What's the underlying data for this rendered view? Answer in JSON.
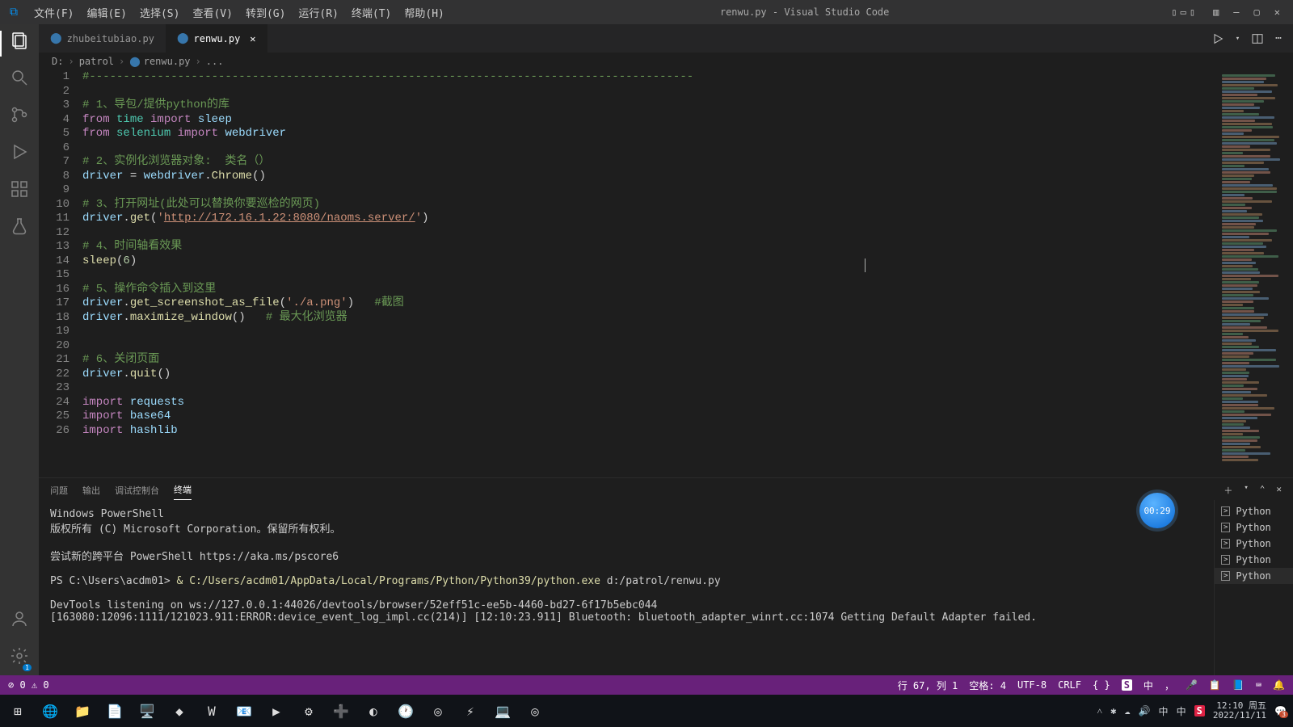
{
  "title": "renwu.py - Visual Studio Code",
  "menu": [
    "文件(F)",
    "编辑(E)",
    "选择(S)",
    "查看(V)",
    "转到(G)",
    "运行(R)",
    "终端(T)",
    "帮助(H)"
  ],
  "tabs": [
    {
      "name": "zhubeitubiao.py",
      "active": false
    },
    {
      "name": "renwu.py",
      "active": true
    }
  ],
  "breadcrumbs": [
    "D:",
    "patrol",
    "renwu.py",
    "..."
  ],
  "code_lines": [
    {
      "n": 1,
      "t": "#-----------------------------------------------------------------------------------------",
      "cls": "comment"
    },
    {
      "n": 2,
      "t": "",
      "cls": ""
    },
    {
      "n": 3,
      "t": "# 1、导包/提供python的库",
      "cls": "comment"
    },
    {
      "n": 4,
      "html": "<span class='c-kw'>from</span> <span class='c-mod'>time</span> <span class='c-kw'>import</span> <span class='c-var'>sleep</span>"
    },
    {
      "n": 5,
      "html": "<span class='c-kw'>from</span> <span class='c-mod'>selenium</span> <span class='c-kw'>import</span> <span class='c-var'>webdriver</span>"
    },
    {
      "n": 6,
      "t": "",
      "cls": ""
    },
    {
      "n": 7,
      "t": "# 2、实例化浏览器对象:  类名（）",
      "cls": "comment"
    },
    {
      "n": 8,
      "html": "<span class='c-var'>driver</span> <span class='c-op'>=</span> <span class='c-var'>webdriver</span><span class='c-op'>.</span><span class='c-fn'>Chrome</span><span class='c-op'>()</span>"
    },
    {
      "n": 9,
      "t": "",
      "cls": ""
    },
    {
      "n": 10,
      "t": "# 3、打开网址(此处可以替换你要巡检的网页)",
      "cls": "comment"
    },
    {
      "n": 11,
      "html": "<span class='c-var'>driver</span><span class='c-op'>.</span><span class='c-fn'>get</span><span class='c-op'>(</span><span class='c-str'>'</span><span class='c-url'>http://172.16.1.22:8080/naoms.server/</span><span class='c-str'>'</span><span class='c-op'>)</span>"
    },
    {
      "n": 12,
      "t": "",
      "cls": ""
    },
    {
      "n": 13,
      "t": "# 4、时间轴看效果",
      "cls": "comment"
    },
    {
      "n": 14,
      "html": "<span class='c-fn'>sleep</span><span class='c-op'>(</span><span class='c-num'>6</span><span class='c-op'>)</span>"
    },
    {
      "n": 15,
      "t": "",
      "cls": ""
    },
    {
      "n": 16,
      "t": "# 5、操作命令插入到这里",
      "cls": "comment"
    },
    {
      "n": 17,
      "html": "<span class='c-var'>driver</span><span class='c-op'>.</span><span class='c-fn'>get_screenshot_as_file</span><span class='c-op'>(</span><span class='c-str'>'./a.png'</span><span class='c-op'>)   </span><span class='c-comment'>#截图</span>"
    },
    {
      "n": 18,
      "html": "<span class='c-var'>driver</span><span class='c-op'>.</span><span class='c-fn'>maximize_window</span><span class='c-op'>()   </span><span class='c-comment'># 最大化浏览器</span>"
    },
    {
      "n": 19,
      "t": "",
      "cls": ""
    },
    {
      "n": 20,
      "t": "",
      "cls": ""
    },
    {
      "n": 21,
      "t": "# 6、关闭页面",
      "cls": "comment"
    },
    {
      "n": 22,
      "html": "<span class='c-var'>driver</span><span class='c-op'>.</span><span class='c-fn'>quit</span><span class='c-op'>()</span>"
    },
    {
      "n": 23,
      "t": "",
      "cls": ""
    },
    {
      "n": 24,
      "html": "<span class='c-kw'>import</span> <span class='c-var'>requests</span>"
    },
    {
      "n": 25,
      "html": "<span class='c-kw'>import</span> <span class='c-var'>base64</span>"
    },
    {
      "n": 26,
      "html": "<span class='c-kw'>import</span> <span class='c-var'>hashlib</span>"
    }
  ],
  "panel_tabs": {
    "problems": "问题",
    "output": "输出",
    "debug": "调试控制台",
    "terminal": "终端"
  },
  "terminal_lines": [
    "Windows PowerShell",
    "版权所有 (C) Microsoft Corporation。保留所有权利。",
    "",
    "尝试新的跨平台 PowerShell https://aka.ms/pscore6",
    "",
    {
      "prompt": "PS C:\\Users\\acdm01>",
      "cmd": " & ",
      "path": "C:/Users/acdm01/AppData/Local/Programs/Python/Python39/python.exe",
      "arg": " d:/patrol/renwu.py"
    },
    "",
    "DevTools listening on ws://127.0.0.1:44026/devtools/browser/52eff51c-ee5b-4460-bd27-6f17b5ebc044",
    "[163080:12096:1111/121023.911:ERROR:device_event_log_impl.cc(214)] [12:10:23.911] Bluetooth: bluetooth_adapter_winrt.cc:1074 Getting Default Adapter failed."
  ],
  "term_sessions": [
    "Python",
    "Python",
    "Python",
    "Python",
    "Python"
  ],
  "status": {
    "errors": "0",
    "warnings": "0",
    "ln": "行 67, 列 1",
    "spaces": "空格: 4",
    "enc": "UTF-8",
    "eol": "CRLF",
    "lang": "{ }",
    "ime_badge": "S",
    "ime_items": [
      "中",
      "，",
      "🎤",
      "📋",
      "📘",
      "⌨"
    ],
    "bell": "🔔"
  },
  "timer": "00:29",
  "system": {
    "time": "12:10 周五",
    "date": "2022/11/11",
    "notif_count": "3"
  },
  "taskbar_icons": [
    "⊞",
    "🌐",
    "📁",
    "📄",
    "🖥️",
    "◆",
    "W",
    "📧",
    "▶",
    "⚙",
    "➕",
    "◐",
    "🕐",
    "◎",
    "⚡",
    "💻",
    "◎"
  ]
}
